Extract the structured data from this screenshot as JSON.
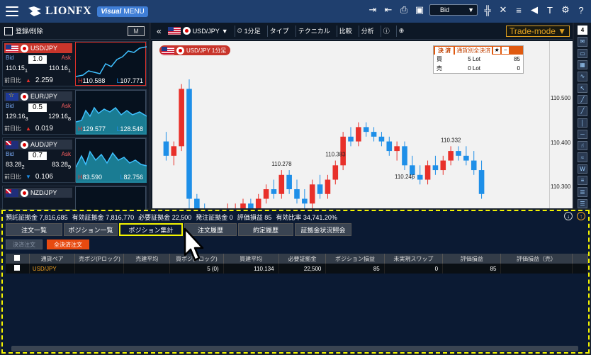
{
  "brand": {
    "name": "LIONFX",
    "menu_v": "Visual",
    "menu_label": "MENU"
  },
  "topbar": {
    "price_type": "Bid",
    "icons": [
      "export-icon",
      "import-icon",
      "print-icon",
      "save-icon",
      "chart-split-icon",
      "cross-icon",
      "news-icon",
      "alert-icon",
      "tools-icon",
      "gear-icon",
      "help-icon"
    ]
  },
  "left": {
    "header": "登録/削除",
    "m_label": "M",
    "pairs": [
      {
        "name": "USD/JPY",
        "spread": "1.0",
        "bid_label": "Bid",
        "ask_label": "Ask",
        "bid_main": "110.15",
        "bid_pip": "1",
        "ask_main": "110.16",
        "ask_pip": "1",
        "prev_label": "前日比",
        "change": "2.259",
        "dir": "up",
        "high": "110.588",
        "low": "107.771",
        "selected": true
      },
      {
        "name": "EUR/JPY",
        "spread": "0.5",
        "bid_label": "Bid",
        "ask_label": "Ask",
        "bid_main": "129.16",
        "bid_pip": "3",
        "ask_main": "129.16",
        "ask_pip": "8",
        "prev_label": "前日比",
        "change": "0.019",
        "dir": "up",
        "high": "129.577",
        "low": "128.548",
        "selected": false
      },
      {
        "name": "AUD/JPY",
        "spread": "0.7",
        "bid_label": "Bid",
        "ask_label": "Ask",
        "bid_main": "83.28",
        "bid_pip": "2",
        "ask_main": "83.28",
        "ask_pip": "9",
        "prev_label": "前日比",
        "change": "0.106",
        "dir": "down",
        "high": "83.590",
        "low": "82.756",
        "selected": false
      },
      {
        "name": "NZD/JPY",
        "spread": "",
        "bid_label": "",
        "ask_label": "",
        "bid_main": "",
        "bid_pip": "",
        "ask_main": "",
        "ask_pip": "",
        "prev_label": "",
        "change": "",
        "dir": "",
        "high": "",
        "low": "",
        "selected": false
      }
    ]
  },
  "chart": {
    "toolbar": {
      "pair": "USD/JPY",
      "timeframe": "1分足",
      "type": "タイプ",
      "technical": "テクニカル",
      "compare": "比較",
      "analysis": "分析",
      "mode": "Trade-mode"
    },
    "badge": "USD/JPY 1分足",
    "settle": {
      "title": "決 済",
      "all_settle": "通貨別全決済",
      "buy_label": "買",
      "buy_qty": "5 Lot",
      "buy_pl": "85",
      "sell_label": "売",
      "sell_qty": "0 Lot",
      "sell_pl": "0"
    },
    "y_ticks": [
      "110.500",
      "110.400",
      "110.300"
    ],
    "annotations": [
      "110.383",
      "110.278",
      "110.332",
      "110.246"
    ]
  },
  "chart_data": {
    "type": "candlestick",
    "title": "USD/JPY 1分足",
    "ylim": [
      110.2,
      110.55
    ],
    "candles": [
      {
        "o": 110.34,
        "h": 110.36,
        "l": 110.3,
        "c": 110.31
      },
      {
        "o": 110.31,
        "h": 110.34,
        "l": 110.29,
        "c": 110.33
      },
      {
        "o": 110.33,
        "h": 110.46,
        "l": 110.32,
        "c": 110.45
      },
      {
        "o": 110.45,
        "h": 110.47,
        "l": 110.2,
        "c": 110.22
      },
      {
        "o": 110.22,
        "h": 110.23,
        "l": 110.19,
        "c": 110.2
      },
      {
        "o": 110.2,
        "h": 110.21,
        "l": 110.18,
        "c": 110.19
      },
      {
        "o": 110.19,
        "h": 110.2,
        "l": 110.17,
        "c": 110.18
      },
      {
        "o": 110.18,
        "h": 110.2,
        "l": 110.17,
        "c": 110.19
      },
      {
        "o": 110.19,
        "h": 110.21,
        "l": 110.18,
        "c": 110.2
      },
      {
        "o": 110.2,
        "h": 110.21,
        "l": 110.19,
        "c": 110.2
      },
      {
        "o": 110.2,
        "h": 110.22,
        "l": 110.19,
        "c": 110.21
      },
      {
        "o": 110.21,
        "h": 110.22,
        "l": 110.18,
        "c": 110.19
      },
      {
        "o": 110.19,
        "h": 110.23,
        "l": 110.18,
        "c": 110.22
      },
      {
        "o": 110.22,
        "h": 110.25,
        "l": 110.21,
        "c": 110.24
      },
      {
        "o": 110.24,
        "h": 110.26,
        "l": 110.22,
        "c": 110.23
      },
      {
        "o": 110.23,
        "h": 110.28,
        "l": 110.22,
        "c": 110.27
      },
      {
        "o": 110.27,
        "h": 110.28,
        "l": 110.23,
        "c": 110.24
      },
      {
        "o": 110.24,
        "h": 110.26,
        "l": 110.21,
        "c": 110.22
      },
      {
        "o": 110.22,
        "h": 110.24,
        "l": 110.2,
        "c": 110.21
      },
      {
        "o": 110.21,
        "h": 110.26,
        "l": 110.2,
        "c": 110.25
      },
      {
        "o": 110.25,
        "h": 110.27,
        "l": 110.22,
        "c": 110.23
      },
      {
        "o": 110.23,
        "h": 110.27,
        "l": 110.22,
        "c": 110.26
      },
      {
        "o": 110.26,
        "h": 110.3,
        "l": 110.25,
        "c": 110.29
      },
      {
        "o": 110.29,
        "h": 110.36,
        "l": 110.28,
        "c": 110.35
      },
      {
        "o": 110.35,
        "h": 110.37,
        "l": 110.33,
        "c": 110.34
      },
      {
        "o": 110.34,
        "h": 110.38,
        "l": 110.33,
        "c": 110.37
      },
      {
        "o": 110.37,
        "h": 110.38,
        "l": 110.35,
        "c": 110.36
      },
      {
        "o": 110.36,
        "h": 110.37,
        "l": 110.34,
        "c": 110.35
      },
      {
        "o": 110.35,
        "h": 110.36,
        "l": 110.33,
        "c": 110.34
      },
      {
        "o": 110.34,
        "h": 110.35,
        "l": 110.31,
        "c": 110.32
      },
      {
        "o": 110.32,
        "h": 110.34,
        "l": 110.3,
        "c": 110.33
      },
      {
        "o": 110.33,
        "h": 110.34,
        "l": 110.28,
        "c": 110.29
      },
      {
        "o": 110.29,
        "h": 110.31,
        "l": 110.26,
        "c": 110.27
      },
      {
        "o": 110.27,
        "h": 110.29,
        "l": 110.25,
        "c": 110.26
      },
      {
        "o": 110.26,
        "h": 110.3,
        "l": 110.25,
        "c": 110.29
      },
      {
        "o": 110.29,
        "h": 110.31,
        "l": 110.27,
        "c": 110.28
      },
      {
        "o": 110.28,
        "h": 110.31,
        "l": 110.27,
        "c": 110.3
      },
      {
        "o": 110.3,
        "h": 110.33,
        "l": 110.29,
        "c": 110.32
      },
      {
        "o": 110.32,
        "h": 110.33,
        "l": 110.3,
        "c": 110.31
      },
      {
        "o": 110.31,
        "h": 110.33,
        "l": 110.29,
        "c": 110.3
      },
      {
        "o": 110.3,
        "h": 110.32,
        "l": 110.27,
        "c": 110.28
      },
      {
        "o": 110.28,
        "h": 110.3,
        "l": 110.22,
        "c": 110.23
      }
    ]
  },
  "summary": {
    "items": [
      {
        "label": "預託証拠金",
        "value": "7,816,685"
      },
      {
        "label": "有効証拠金",
        "value": "7,816,770"
      },
      {
        "label": "必要証拠金",
        "value": "22,500"
      },
      {
        "label": "発注証拠金",
        "value": "0"
      },
      {
        "label": "評価損益",
        "value": "85"
      },
      {
        "label": "有効比率",
        "value": "34,741.20%"
      }
    ]
  },
  "tabs": [
    "注文一覧",
    "ポジション一覧",
    "ポジション集計",
    "注文履歴",
    "約定履歴",
    "証拠金状況照会"
  ],
  "active_tab": 2,
  "buttons": {
    "settle_order": "決済注文",
    "all_settle_order": "全決済注文"
  },
  "table": {
    "headers": [
      "通貨ペア",
      "売ポジ(Pロック)",
      "売建平均",
      "買ポジ(Pロック)",
      "買建平均",
      "必要証拠金",
      "ポジション損益",
      "未実現スワップ",
      "評価損益",
      "評価損益（売）"
    ],
    "rows": [
      [
        "USD/JPY",
        "",
        "",
        "5 (0)",
        "110.134",
        "22,500",
        "85",
        "0",
        "85",
        ""
      ]
    ]
  },
  "colors": {
    "up": "#e8302a",
    "down": "#1e8fe8",
    "accent": "#f5f500",
    "brand": "#1f3f6e"
  }
}
